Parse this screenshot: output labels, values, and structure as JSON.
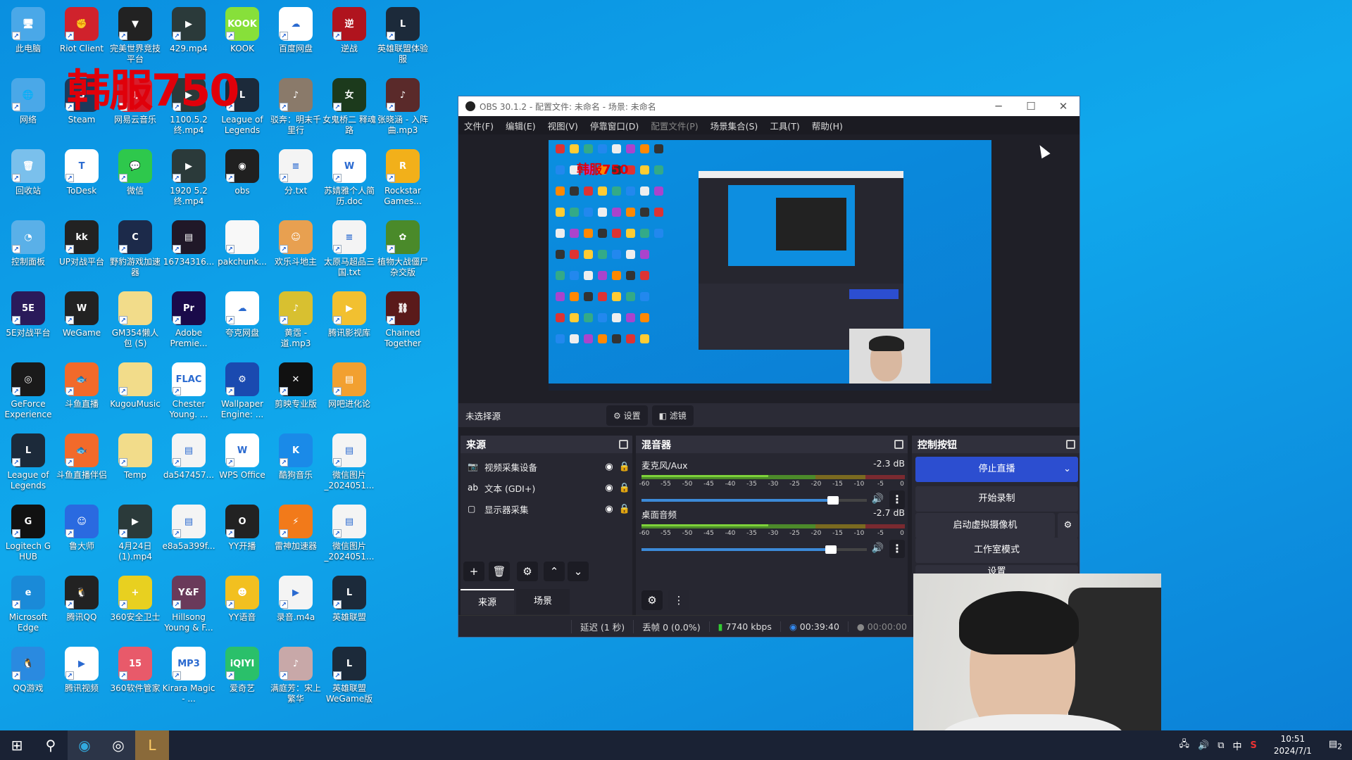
{
  "desktop": {
    "watermark": "韩服750",
    "rows": [
      [
        {
          "label": "此电脑",
          "color": "#4aa8e8",
          "glyph": "🖥"
        },
        {
          "label": "Riot Client",
          "color": "#d0222c",
          "glyph": "✊"
        },
        {
          "label": "完美世界竞技平台",
          "color": "#222",
          "glyph": "▼"
        },
        {
          "label": "429.mp4",
          "color": "#2b3a3a",
          "glyph": "▶"
        },
        {
          "label": "KOOK",
          "color": "#87e03a",
          "glyph": "KOOK"
        },
        {
          "label": "百度网盘",
          "color": "#ffffff",
          "glyph": "☁"
        },
        {
          "label": "逆战",
          "color": "#b0141e",
          "glyph": "逆"
        },
        {
          "label": "英雄联盟体验服",
          "color": "#1c2a3a",
          "glyph": "L"
        }
      ],
      [
        {
          "label": "网络",
          "color": "#4aa8e8",
          "glyph": "🌐"
        },
        {
          "label": "Steam",
          "color": "#1b3a5c",
          "glyph": "S"
        },
        {
          "label": "网易云音乐",
          "color": "#d81e2c",
          "glyph": "♫"
        },
        {
          "label": "1100.5.2终.mp4",
          "color": "#2b3a3a",
          "glyph": "▶"
        },
        {
          "label": "League of Legends",
          "color": "#1c2a3a",
          "glyph": "L"
        },
        {
          "label": "驳奔：明末千里行",
          "color": "#8a7a6a",
          "glyph": "♪"
        },
        {
          "label": "女鬼桥二 释魂路",
          "color": "#1c3a1c",
          "glyph": "女"
        },
        {
          "label": "张晓涵 - 入阵曲.mp3",
          "color": "#5a2a2a",
          "glyph": "♪"
        }
      ],
      [
        {
          "label": "回收站",
          "color": "#7ac0ec",
          "glyph": "🗑"
        },
        {
          "label": "ToDesk",
          "color": "#ffffff",
          "glyph": "T"
        },
        {
          "label": "微信",
          "color": "#2ec84c",
          "glyph": "💬"
        },
        {
          "label": "1920 5.2终.mp4",
          "color": "#2b3a3a",
          "glyph": "▶"
        },
        {
          "label": "obs",
          "color": "#202020",
          "glyph": "◉"
        },
        {
          "label": "分.txt",
          "color": "#f4f4f4",
          "glyph": "≡"
        },
        {
          "label": "苏婧雅个人简历.doc",
          "color": "#ffffff",
          "glyph": "W"
        },
        {
          "label": "Rockstar Games...",
          "color": "#f2b01a",
          "glyph": "R"
        }
      ],
      [
        {
          "label": "控制面板",
          "color": "#5ab0e8",
          "glyph": "◔"
        },
        {
          "label": "UP对战平台",
          "color": "#222",
          "glyph": "kk"
        },
        {
          "label": "野豹游戏加速器",
          "color": "#1c2a4a",
          "glyph": "C"
        },
        {
          "label": "16734316...",
          "color": "#201828",
          "glyph": "▤"
        },
        {
          "label": "pakchunk...",
          "color": "#f8f8f8",
          "glyph": ""
        },
        {
          "label": "欢乐斗地主",
          "color": "#e8a050",
          "glyph": "☺"
        },
        {
          "label": "太原马超品三国.txt",
          "color": "#f4f4f4",
          "glyph": "≡"
        },
        {
          "label": "植物大战僵尸杂交版",
          "color": "#4a8a2a",
          "glyph": "✿"
        }
      ],
      [
        {
          "label": "5E对战平台",
          "color": "#2a1a5a",
          "glyph": "5E"
        },
        {
          "label": "WeGame",
          "color": "#222",
          "glyph": "W"
        },
        {
          "label": "GM354懒人包 (S)",
          "color": "#f2dc8a",
          "glyph": ""
        },
        {
          "label": "Adobe Premie...",
          "color": "#1a0a4a",
          "glyph": "Pr"
        },
        {
          "label": "夸克网盘",
          "color": "#ffffff",
          "glyph": "☁"
        },
        {
          "label": "黄霑 - 道.mp3",
          "color": "#d8c030",
          "glyph": "♪"
        },
        {
          "label": "腾讯影视库",
          "color": "#f2c030",
          "glyph": "▶"
        },
        {
          "label": "Chained Together",
          "color": "#5a1a1a",
          "glyph": "⛓"
        }
      ],
      [
        {
          "label": "GeForce Experience",
          "color": "#1a1a1a",
          "glyph": "◎"
        },
        {
          "label": "斗鱼直播",
          "color": "#f26a2a",
          "glyph": "🐟"
        },
        {
          "label": "KugouMusic",
          "color": "#f2dc8a",
          "glyph": ""
        },
        {
          "label": "Chester Young. ...",
          "color": "#ffffff",
          "glyph": "FLAC"
        },
        {
          "label": "Wallpaper Engine: ...",
          "color": "#1a4ab0",
          "glyph": "⚙"
        },
        {
          "label": "剪映专业版",
          "color": "#111",
          "glyph": "✕"
        },
        {
          "label": "网吧进化论",
          "color": "#f2a030",
          "glyph": "▤"
        }
      ],
      [
        {
          "label": "League of Legends",
          "color": "#1c2a3a",
          "glyph": "L"
        },
        {
          "label": "斗鱼直播伴侣",
          "color": "#f26a2a",
          "glyph": "🐟"
        },
        {
          "label": "Temp",
          "color": "#f2dc8a",
          "glyph": ""
        },
        {
          "label": "da547457...",
          "color": "#f4f4f4",
          "glyph": "▤"
        },
        {
          "label": "WPS Office",
          "color": "#ffffff",
          "glyph": "W"
        },
        {
          "label": "酷狗音乐",
          "color": "#1a8ae8",
          "glyph": "K"
        },
        {
          "label": "微信图片_2024051...",
          "color": "#f4f4f4",
          "glyph": "▤"
        }
      ],
      [
        {
          "label": "Logitech G HUB",
          "color": "#111",
          "glyph": "G"
        },
        {
          "label": "鲁大师",
          "color": "#2a6ae0",
          "glyph": "☺"
        },
        {
          "label": "4月24日(1).mp4",
          "color": "#2b3a3a",
          "glyph": "▶"
        },
        {
          "label": "e8a5a399f...",
          "color": "#f4f4f4",
          "glyph": "▤"
        },
        {
          "label": "YY开播",
          "color": "#222",
          "glyph": "O"
        },
        {
          "label": "雷神加速器",
          "color": "#f27a1a",
          "glyph": "⚡"
        },
        {
          "label": "微信图片_2024051...",
          "color": "#f4f4f4",
          "glyph": "▤"
        }
      ],
      [
        {
          "label": "Microsoft Edge",
          "color": "#1a8ad8",
          "glyph": "e"
        },
        {
          "label": "腾讯QQ",
          "color": "#222",
          "glyph": "🐧"
        },
        {
          "label": "360安全卫士",
          "color": "#e8d020",
          "glyph": "+"
        },
        {
          "label": "Hillsong Young & F...",
          "color": "#6a3a5a",
          "glyph": "Y&F"
        },
        {
          "label": "YY语音",
          "color": "#f2c020",
          "glyph": "☻"
        },
        {
          "label": "录音.m4a",
          "color": "#f4f4f4",
          "glyph": "▶"
        },
        {
          "label": "英雄联盟",
          "color": "#1c2a3a",
          "glyph": "L"
        }
      ],
      [
        {
          "label": "QQ游戏",
          "color": "#2a8ae0",
          "glyph": "🐧"
        },
        {
          "label": "腾讯视频",
          "color": "#ffffff",
          "glyph": "▶"
        },
        {
          "label": "360软件管家",
          "color": "#e85a6a",
          "glyph": "15"
        },
        {
          "label": "Kirara Magic - ...",
          "color": "#ffffff",
          "glyph": "MP3"
        },
        {
          "label": "爱奇艺",
          "color": "#2ac06a",
          "glyph": "iQIYI"
        },
        {
          "label": "满庭芳：宋上繁华",
          "color": "#c8a8a8",
          "glyph": "♪"
        },
        {
          "label": "英雄联盟WeGame版",
          "color": "#1c2a3a",
          "glyph": "L"
        }
      ]
    ]
  },
  "obs": {
    "title": "OBS 30.1.2 - 配置文件: 未命名 - 场景: 未命名",
    "window_controls": [
      "─",
      "☐",
      "✕"
    ],
    "menu": [
      {
        "label": "文件(F)"
      },
      {
        "label": "编辑(E)"
      },
      {
        "label": "视图(V)"
      },
      {
        "label": "停靠窗口(D)"
      },
      {
        "label": "配置文件(P)",
        "disabled": true
      },
      {
        "label": "场景集合(S)"
      },
      {
        "label": "工具(T)"
      },
      {
        "label": "帮助(H)"
      }
    ],
    "preview_watermark": "韩服750",
    "source_bar": {
      "label": "未选择源",
      "settings": "设置",
      "filters": "滤镜"
    },
    "sources": {
      "title": "来源",
      "items": [
        {
          "icon": "camera",
          "name": "视频采集设备",
          "visible": true,
          "locked": true
        },
        {
          "icon": "text",
          "name": "文本 (GDI+)",
          "visible": true,
          "locked": true
        },
        {
          "icon": "monitor",
          "name": "显示器采集",
          "visible": true,
          "locked": true
        }
      ],
      "tabs": [
        "来源",
        "场景"
      ],
      "active_tab": "来源"
    },
    "mixer": {
      "title": "混音器",
      "ticks": [
        "-60",
        "-55",
        "-50",
        "-45",
        "-40",
        "-35",
        "-30",
        "-25",
        "-20",
        "-15",
        "-10",
        "-5",
        "0"
      ],
      "channels": [
        {
          "name": "麦克风/Aux",
          "db": "-2.3 dB",
          "volume": 0.85
        },
        {
          "name": "桌面音频",
          "db": "-2.7 dB",
          "volume": 0.84
        }
      ]
    },
    "controls": {
      "title": "控制按钮",
      "stop_stream": "停止直播",
      "start_recording": "开始录制",
      "virtual_camera": "启动虚拟摄像机",
      "studio_mode": "工作室模式",
      "settings": "设置",
      "accent": "#2c4ed0"
    },
    "status": {
      "delay": "延迟 (1 秒)",
      "dropped": "丢帧 0 (0.0%)",
      "bitrate": "7740 kbps",
      "stream_time": "00:39:40",
      "record_time": "00:00:00"
    }
  },
  "taskbar": {
    "tray": {
      "ime": "中",
      "time": "10:51",
      "date": "2024/7/1",
      "notifications": "2"
    }
  }
}
